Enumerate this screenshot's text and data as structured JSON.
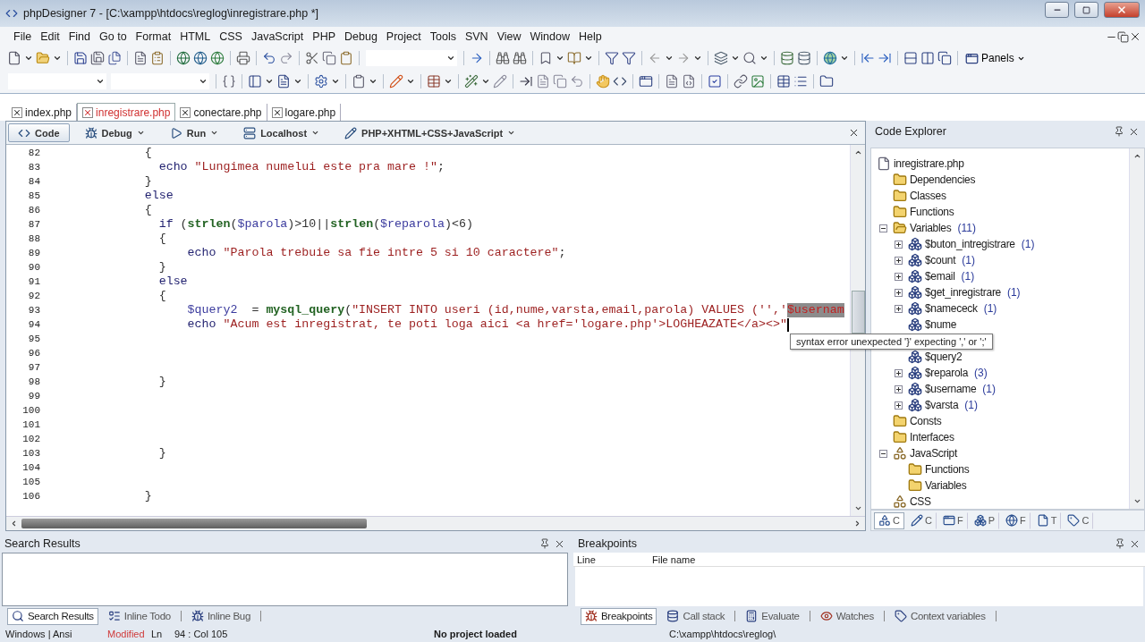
{
  "window": {
    "title": "phpDesigner 7 - [C:\\xampp\\htdocs\\reglog\\inregistrare.php *]"
  },
  "menu": [
    "File",
    "Edit",
    "Find",
    "Go to",
    "Format",
    "HTML",
    "CSS",
    "JavaScript",
    "PHP",
    "Debug",
    "Project",
    "Tools",
    "SVN",
    "View",
    "Window",
    "Help"
  ],
  "toolbar": {
    "panels_button": "Panels"
  },
  "file_tabs": [
    {
      "label": "index.php",
      "selected": false
    },
    {
      "label": "inregistrare.php",
      "selected": true
    },
    {
      "label": "conectare.php",
      "selected": false
    },
    {
      "label": "logare.php",
      "selected": false
    }
  ],
  "editor_toolbar": [
    {
      "kind": "code",
      "label": "Code",
      "selected": true,
      "dropdown": false
    },
    {
      "kind": "debug",
      "label": "Debug",
      "selected": false,
      "dropdown": true
    },
    {
      "kind": "run",
      "label": "Run",
      "selected": false,
      "dropdown": true
    },
    {
      "kind": "server",
      "label": "Localhost",
      "selected": false,
      "dropdown": true
    },
    {
      "kind": "syntax",
      "label": "PHP+XHTML+CSS+JavaScript",
      "selected": false,
      "dropdown": true
    }
  ],
  "code": {
    "lines": [
      {
        "number": "82",
        "tokens": [
          {
            "kind": "plain",
            "text": "              {"
          }
        ]
      },
      {
        "number": "83",
        "tokens": [
          {
            "kind": "keyword",
            "text": "                echo "
          },
          {
            "kind": "string",
            "text": "\"Lungimea numelui este pra mare !\""
          },
          {
            "kind": "plain",
            "text": ";"
          }
        ]
      },
      {
        "number": "84",
        "tokens": [
          {
            "kind": "plain",
            "text": "              }"
          }
        ]
      },
      {
        "number": "85",
        "tokens": [
          {
            "kind": "keyword",
            "text": "              else"
          }
        ]
      },
      {
        "number": "86",
        "tokens": [
          {
            "kind": "plain",
            "text": "              {"
          }
        ]
      },
      {
        "number": "87",
        "tokens": [
          {
            "kind": "keyword",
            "text": "                if"
          },
          {
            "kind": "plain",
            "text": " ("
          },
          {
            "kind": "function",
            "text": "strlen"
          },
          {
            "kind": "plain",
            "text": "("
          },
          {
            "kind": "variable",
            "text": "$parola"
          },
          {
            "kind": "plain",
            "text": ")>10||"
          },
          {
            "kind": "function",
            "text": "strlen"
          },
          {
            "kind": "plain",
            "text": "("
          },
          {
            "kind": "variable",
            "text": "$reparola"
          },
          {
            "kind": "plain",
            "text": ")<6)"
          }
        ]
      },
      {
        "number": "88",
        "tokens": [
          {
            "kind": "plain",
            "text": "                {"
          }
        ]
      },
      {
        "number": "89",
        "tokens": [
          {
            "kind": "keyword",
            "text": "                    echo "
          },
          {
            "kind": "string",
            "text": "\"Parola trebuie sa fie intre 5 si 10 caractere\""
          },
          {
            "kind": "plain",
            "text": ";"
          }
        ]
      },
      {
        "number": "90",
        "tokens": [
          {
            "kind": "plain",
            "text": "                }"
          }
        ]
      },
      {
        "number": "91",
        "tokens": [
          {
            "kind": "keyword",
            "text": "                else"
          }
        ]
      },
      {
        "number": "92",
        "tokens": [
          {
            "kind": "plain",
            "text": "                {"
          }
        ]
      },
      {
        "number": "93",
        "tokens": [
          {
            "kind": "variable",
            "text": "                    $query2"
          },
          {
            "kind": "plain",
            "text": "  = "
          },
          {
            "kind": "function",
            "text": "mysql_query"
          },
          {
            "kind": "plain",
            "text": "("
          },
          {
            "kind": "string",
            "text": "\"INSERT INTO useri (id,nume,varsta,email,parola) VALUES ('','"
          },
          {
            "kind": "error",
            "text": "$usernam"
          }
        ]
      },
      {
        "number": "94",
        "caret": true,
        "tokens": [
          {
            "kind": "keyword",
            "text": "                    echo "
          },
          {
            "kind": "string",
            "text": "\"Acum est inregistrat, te poti loga aici <a href='logare.php'>LOGHEAZATE</a><>\""
          }
        ]
      },
      {
        "number": "95"
      },
      {
        "number": "96"
      },
      {
        "number": "97"
      },
      {
        "number": "98",
        "tokens": [
          {
            "kind": "plain",
            "text": "                }"
          }
        ]
      },
      {
        "number": "99"
      },
      {
        "number": "100"
      },
      {
        "number": "101"
      },
      {
        "number": "102"
      },
      {
        "number": "103",
        "tokens": [
          {
            "kind": "plain",
            "text": "                }"
          }
        ]
      },
      {
        "number": "104"
      },
      {
        "number": "105"
      },
      {
        "number": "106",
        "tokens": [
          {
            "kind": "plain",
            "text": "              }"
          }
        ]
      }
    ],
    "tooltip": "syntax error unexpected '}' expecting ',' or ';'"
  },
  "code_explorer": {
    "title": "Code Explorer",
    "tree": [
      {
        "kind": "file",
        "label": "inregistrare.php",
        "children": [
          {
            "kind": "folder",
            "label": "Dependencies"
          },
          {
            "kind": "folder",
            "label": "Classes"
          },
          {
            "kind": "folder",
            "label": "Functions"
          },
          {
            "kind": "folder",
            "label": "Variables",
            "count": "(11)",
            "expanded": true,
            "children": [
              {
                "kind": "variable",
                "label": "$buton_intregistrare",
                "count": "(1)",
                "expanded": false
              },
              {
                "kind": "variable",
                "label": "$count",
                "count": "(1)",
                "expanded": false
              },
              {
                "kind": "variable",
                "label": "$email",
                "count": "(1)",
                "expanded": false
              },
              {
                "kind": "variable",
                "label": "$get_inregistrare",
                "count": "(1)",
                "expanded": false
              },
              {
                "kind": "variable",
                "label": "$namececk",
                "count": "(1)",
                "expanded": false
              },
              {
                "kind": "variable",
                "label": "$nume"
              },
              {
                "kind": "hidden"
              },
              {
                "kind": "variable",
                "label": "$query2"
              },
              {
                "kind": "variable",
                "label": "$reparola",
                "count": "(3)",
                "expanded": false
              },
              {
                "kind": "variable",
                "label": "$username",
                "count": "(1)",
                "expanded": false
              },
              {
                "kind": "variable",
                "label": "$varsta",
                "count": "(1)",
                "expanded": false
              }
            ]
          },
          {
            "kind": "folder",
            "label": "Consts"
          },
          {
            "kind": "folder",
            "label": "Interfaces"
          },
          {
            "kind": "group",
            "label": "JavaScript",
            "expanded": true,
            "children": [
              {
                "kind": "folder",
                "label": "Functions"
              },
              {
                "kind": "folder",
                "label": "Variables"
              }
            ]
          },
          {
            "kind": "group",
            "label": "CSS"
          }
        ]
      }
    ],
    "tabs": [
      {
        "kind": "explorer",
        "label": "C",
        "selected": true
      },
      {
        "kind": "edit",
        "label": "C",
        "selected": false
      },
      {
        "kind": "window",
        "label": "F",
        "selected": false
      },
      {
        "kind": "project",
        "label": "P",
        "selected": false
      },
      {
        "kind": "globe",
        "label": "F",
        "selected": false
      },
      {
        "kind": "page",
        "label": "T",
        "selected": false
      },
      {
        "kind": "tag",
        "label": "C",
        "selected": false
      }
    ]
  },
  "search_results": {
    "title": "Search Results",
    "tabs": [
      {
        "kind": "search",
        "label": "Search Results",
        "selected": true
      },
      {
        "kind": "todo",
        "label": "Inline Todo",
        "selected": false
      },
      {
        "kind": "bug",
        "label": "Inline Bug",
        "selected": false
      }
    ]
  },
  "breakpoints": {
    "title": "Breakpoints",
    "columns": [
      "Line",
      "File name"
    ],
    "tabs": [
      {
        "kind": "breakpoint",
        "label": "Breakpoints",
        "selected": true
      },
      {
        "kind": "stack",
        "label": "Call stack",
        "selected": false
      },
      {
        "kind": "calc",
        "label": "Evaluate",
        "selected": false
      },
      {
        "kind": "watch",
        "label": "Watches",
        "selected": false
      },
      {
        "kind": "context",
        "label": "Context variables",
        "selected": false
      }
    ]
  },
  "status_bar": {
    "encoding": "Windows | Ansi",
    "modified": "Modified",
    "ln": "Ln",
    "position": "94 : Col 105",
    "project": "No project loaded",
    "path": "C:\\xampp\\htdocs\\reglog\\"
  }
}
